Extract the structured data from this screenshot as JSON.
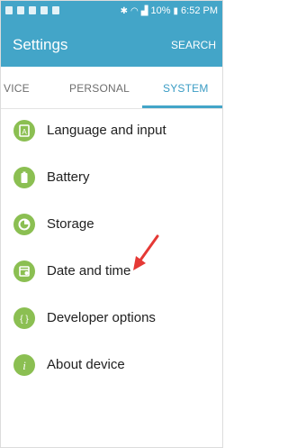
{
  "status_bar": {
    "battery_text": "10%",
    "time": "6:52 PM"
  },
  "app_bar": {
    "title": "Settings",
    "search_label": "SEARCH"
  },
  "tabs": [
    {
      "label": "VICE"
    },
    {
      "label": "PERSONAL"
    },
    {
      "label": "SYSTEM",
      "active": true
    }
  ],
  "menu": [
    {
      "label": "Language and input",
      "icon": "language-icon"
    },
    {
      "label": "Battery",
      "icon": "battery-icon"
    },
    {
      "label": "Storage",
      "icon": "storage-icon"
    },
    {
      "label": "Date and time",
      "icon": "calendar-icon"
    },
    {
      "label": "Developer options",
      "icon": "developer-icon"
    },
    {
      "label": "About device",
      "icon": "info-icon"
    }
  ],
  "colors": {
    "header": "#43a5c8",
    "accent": "#3a9cc4",
    "icon_bg": "#8bbf52",
    "arrow": "#e53935"
  }
}
